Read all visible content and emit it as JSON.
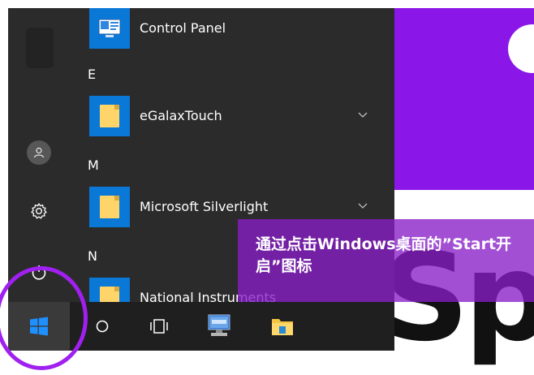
{
  "start_menu": {
    "apps": [
      {
        "type": "app",
        "label": "Control Panel",
        "icon": "control-panel-icon",
        "expandable": false
      },
      {
        "type": "letter",
        "label": "E"
      },
      {
        "type": "app",
        "label": "eGalaxTouch",
        "icon": "folder-icon",
        "expandable": true
      },
      {
        "type": "letter",
        "label": "M"
      },
      {
        "type": "app",
        "label": "Microsoft Silverlight",
        "icon": "folder-icon",
        "expandable": true
      },
      {
        "type": "letter",
        "label": "N"
      },
      {
        "type": "app",
        "label": "National Instruments",
        "icon": "folder-icon",
        "expandable": true
      }
    ],
    "rail": {
      "user_icon": "user-icon",
      "settings_icon": "gear-icon",
      "power_icon": "power-icon"
    }
  },
  "taskbar": {
    "items": [
      "windows-logo-icon",
      "search-circle-icon",
      "task-view-icon",
      "network-computer-icon",
      "file-explorer-icon"
    ]
  },
  "tiles": {
    "big_text": "Sp"
  },
  "annotation": {
    "text": "通过点击Windows桌面的”Start开启”图标"
  },
  "colors": {
    "menu_bg": "#2b2b2b",
    "accent_blue": "#0a78d7",
    "tile_purple": "#8a17e8",
    "annotation_purple": "#8a1ec8",
    "highlight_ring": "#a020f0"
  }
}
